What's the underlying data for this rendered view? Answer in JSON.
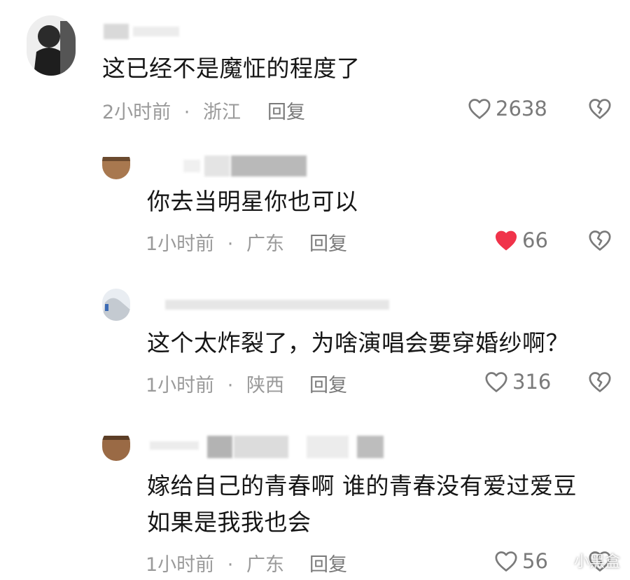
{
  "comments": [
    {
      "text": "这已经不是魔怔的程度了",
      "time": "2小时前",
      "location": "浙江",
      "reply": "回复",
      "likes": "2638",
      "liked": false
    },
    {
      "text": "你去当明星你也可以",
      "time": "1小时前",
      "location": "广东",
      "reply": "回复",
      "likes": "66",
      "liked": true
    },
    {
      "text": "这个太炸裂了，为啥演唱会要穿婚纱啊？",
      "time": "1小时前",
      "location": "陕西",
      "reply": "回复",
      "likes": "316",
      "liked": false
    },
    {
      "text_lines": [
        "嫁给自己的青春啊 谁的青春没有爱过爱豆",
        "如果是我我也会"
      ],
      "time": "1小时前",
      "location": "广东",
      "reply": "回复",
      "likes": "56",
      "liked": false
    }
  ],
  "separator": "·",
  "watermark": "小黑盒",
  "colors": {
    "like_active": "#f0334a",
    "meta": "#9a9a9a"
  }
}
